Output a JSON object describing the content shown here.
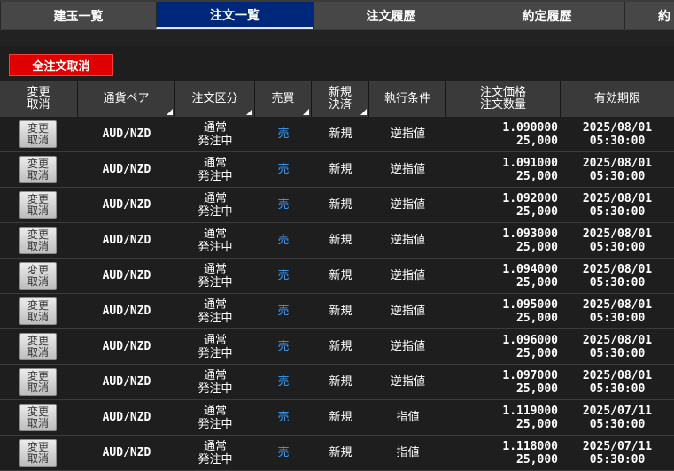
{
  "tabs": [
    {
      "label": "建玉一覧",
      "active": false
    },
    {
      "label": "注文一覧",
      "active": true
    },
    {
      "label": "注文履歴",
      "active": false
    },
    {
      "label": "約定履歴",
      "active": false
    },
    {
      "label": "約",
      "active": false
    }
  ],
  "actions": {
    "cancel_all_label": "全注文取消"
  },
  "table": {
    "headers": {
      "action": "変更\n取消",
      "pair": "通貨ペア",
      "order_type": "注文区分",
      "side": "売買",
      "new_close": "新規\n決済",
      "condition": "執行条件",
      "price_qty": "注文価格\n注文数量",
      "expiry": "有効期限"
    },
    "rows": [
      {
        "button": "変更\n取消",
        "pair": "AUD/NZD",
        "status": "通常\n発注中",
        "side": "売",
        "new_close": "新規",
        "condition": "逆指値",
        "price": "1.090000",
        "qty": "25,000",
        "expiry_date": "2025/08/01",
        "expiry_time": "05:30:00"
      },
      {
        "button": "変更\n取消",
        "pair": "AUD/NZD",
        "status": "通常\n発注中",
        "side": "売",
        "new_close": "新規",
        "condition": "逆指値",
        "price": "1.091000",
        "qty": "25,000",
        "expiry_date": "2025/08/01",
        "expiry_time": "05:30:00"
      },
      {
        "button": "変更\n取消",
        "pair": "AUD/NZD",
        "status": "通常\n発注中",
        "side": "売",
        "new_close": "新規",
        "condition": "逆指値",
        "price": "1.092000",
        "qty": "25,000",
        "expiry_date": "2025/08/01",
        "expiry_time": "05:30:00"
      },
      {
        "button": "変更\n取消",
        "pair": "AUD/NZD",
        "status": "通常\n発注中",
        "side": "売",
        "new_close": "新規",
        "condition": "逆指値",
        "price": "1.093000",
        "qty": "25,000",
        "expiry_date": "2025/08/01",
        "expiry_time": "05:30:00"
      },
      {
        "button": "変更\n取消",
        "pair": "AUD/NZD",
        "status": "通常\n発注中",
        "side": "売",
        "new_close": "新規",
        "condition": "逆指値",
        "price": "1.094000",
        "qty": "25,000",
        "expiry_date": "2025/08/01",
        "expiry_time": "05:30:00"
      },
      {
        "button": "変更\n取消",
        "pair": "AUD/NZD",
        "status": "通常\n発注中",
        "side": "売",
        "new_close": "新規",
        "condition": "逆指値",
        "price": "1.095000",
        "qty": "25,000",
        "expiry_date": "2025/08/01",
        "expiry_time": "05:30:00"
      },
      {
        "button": "変更\n取消",
        "pair": "AUD/NZD",
        "status": "通常\n発注中",
        "side": "売",
        "new_close": "新規",
        "condition": "逆指値",
        "price": "1.096000",
        "qty": "25,000",
        "expiry_date": "2025/08/01",
        "expiry_time": "05:30:00"
      },
      {
        "button": "変更\n取消",
        "pair": "AUD/NZD",
        "status": "通常\n発注中",
        "side": "売",
        "new_close": "新規",
        "condition": "逆指値",
        "price": "1.097000",
        "qty": "25,000",
        "expiry_date": "2025/08/01",
        "expiry_time": "05:30:00"
      },
      {
        "button": "変更\n取消",
        "pair": "AUD/NZD",
        "status": "通常\n発注中",
        "side": "売",
        "new_close": "新規",
        "condition": "指値",
        "price": "1.119000",
        "qty": "25,000",
        "expiry_date": "2025/07/11",
        "expiry_time": "05:30:00"
      },
      {
        "button": "変更\n取消",
        "pair": "AUD/NZD",
        "status": "通常\n発注中",
        "side": "売",
        "new_close": "新規",
        "condition": "指値",
        "price": "1.118000",
        "qty": "25,000",
        "expiry_date": "2025/07/11",
        "expiry_time": "05:30:00"
      }
    ]
  },
  "colors": {
    "active_tab": "#00287a",
    "cancel_all": "#e10000",
    "sell": "#3aa0ff",
    "background": "#1e1e1e"
  }
}
